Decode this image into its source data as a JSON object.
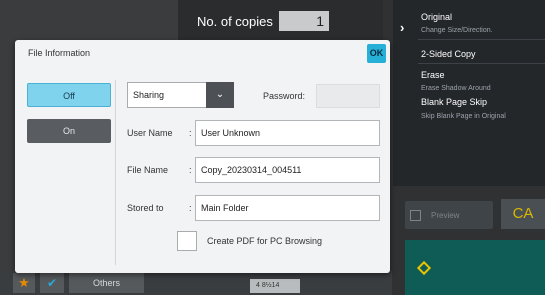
{
  "copies": {
    "label": "No. of copies",
    "value": "1"
  },
  "right_panel": {
    "original": "Original",
    "original_sub": "Change Size/Direction.",
    "two_sided": "2-Sided Copy",
    "erase": "Erase",
    "erase_sub": "Erase Shadow Around",
    "blank_skip": "Blank Page Skip",
    "blank_skip_sub": "Skip Blank Page in Original",
    "preview": "Preview",
    "ca": "CA"
  },
  "bottom": {
    "others": "Others",
    "paper": "4 8½14"
  },
  "dialog": {
    "title": "File Information",
    "ok": "OK",
    "off": "Off",
    "on": "On",
    "sharing": "Sharing",
    "password_label": "Password:",
    "password_value": "",
    "user_name_label": "User Name",
    "user_name_value": "User Unknown",
    "file_name_label": "File Name",
    "file_name_value": "Copy_20230314_004511",
    "stored_to_label": "Stored to",
    "stored_to_value": "Main Folder",
    "pdf_checkbox_label": "Create PDF for PC Browsing",
    "pdf_checked": false
  },
  "colors": {
    "accent": "#26b0d8",
    "selected_toggle": "#7fd3ec",
    "ca": "#d9b800"
  }
}
